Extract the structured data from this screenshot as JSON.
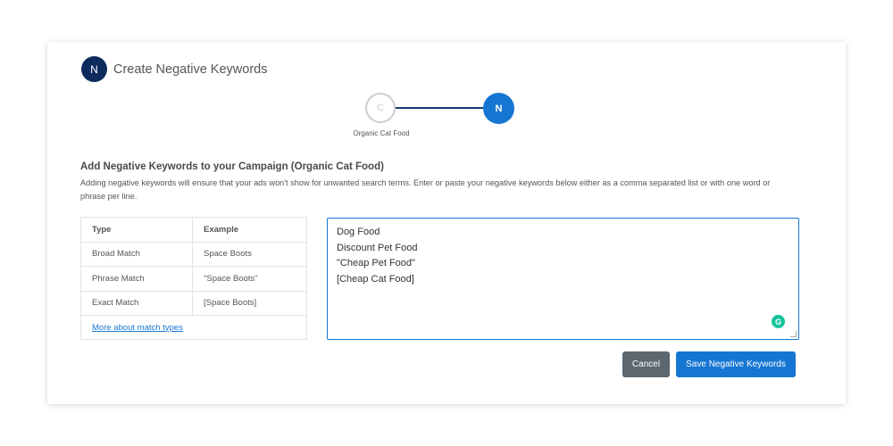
{
  "header": {
    "avatar_letter": "N",
    "title": "Create Negative Keywords"
  },
  "stepper": {
    "steps": [
      {
        "letter": "C",
        "label": "Organic Cat Food",
        "state": "inactive"
      },
      {
        "letter": "N",
        "label": "",
        "state": "active"
      }
    ]
  },
  "section": {
    "title": "Add Negative Keywords to your Campaign (Organic Cat Food)",
    "description": "Adding negative keywords will ensure that your ads won't show for unwanted search terms. Enter or paste your negative keywords below either as a comma separated list or with one word or phrase per line."
  },
  "match_table": {
    "headers": [
      "Type",
      "Example"
    ],
    "rows": [
      [
        "Broad Match",
        "Space Boots"
      ],
      [
        "Phrase Match",
        "\"Space Boots\""
      ],
      [
        "Exact Match",
        "[Space Boots]"
      ]
    ],
    "link_label": "More about match types"
  },
  "keywords": {
    "value": "Dog Food\nDiscount Pet Food\n\"Cheap Pet Food\"\n[Cheap Cat Food]",
    "grammarly_letter": "G"
  },
  "actions": {
    "cancel_label": "Cancel",
    "save_label": "Save Negative Keywords"
  },
  "colors": {
    "primary": "#1576d2",
    "avatar": "#0d2b5c",
    "cancel": "#5c6770",
    "grammarly": "#15c39a"
  }
}
